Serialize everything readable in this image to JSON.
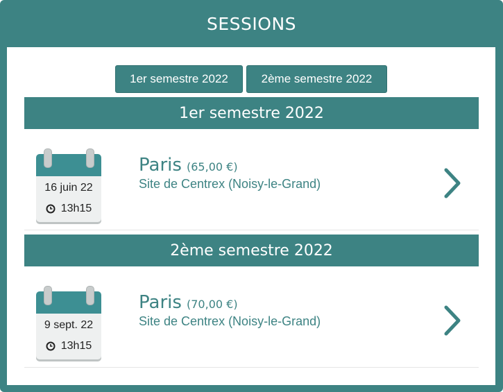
{
  "header": {
    "title": "SESSIONS"
  },
  "tabs": [
    {
      "label": "1er semestre 2022"
    },
    {
      "label": "2ème semestre 2022"
    }
  ],
  "sections": [
    {
      "title": "1er semestre 2022",
      "session": {
        "date": "16 juin 22",
        "time": "13h15",
        "city": "Paris",
        "price": "(65,00 €)",
        "site": "Site de Centrex (Noisy-le-Grand)"
      }
    },
    {
      "title": "2ème semestre 2022",
      "session": {
        "date": "9 sept. 22",
        "time": "13h15",
        "city": "Paris",
        "price": "(70,00 €)",
        "site": "Site de Centrex (Noisy-le-Grand)"
      }
    }
  ],
  "icons": {
    "calendar": "calendar-icon",
    "clock": "clock-icon",
    "arrow": "chevron-right-icon"
  },
  "colors": {
    "accent": "#3d8383",
    "calendar_top": "#3d8f93",
    "calendar_body": "#eef0f0"
  }
}
